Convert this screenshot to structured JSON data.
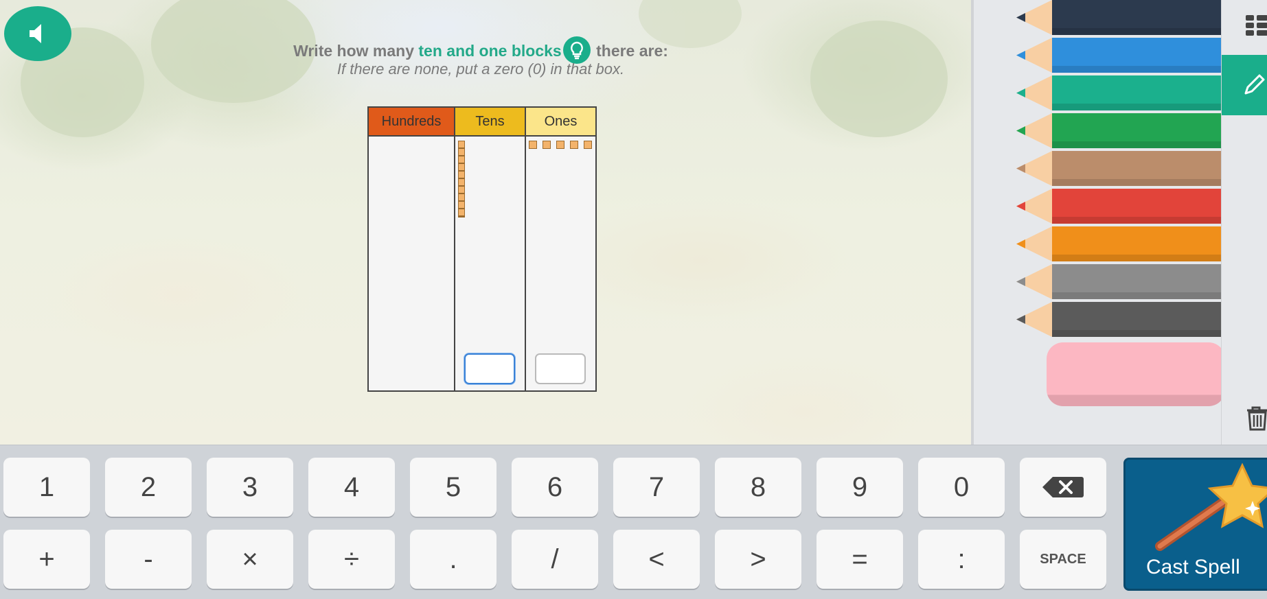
{
  "prompt": {
    "part1": "Write how many ",
    "highlight": "ten and one blocks",
    "part2": " there are:",
    "line2": "If there are none, put a zero (0) in that box."
  },
  "place_value": {
    "headers": [
      "Hundreds",
      "Tens",
      "Ones"
    ],
    "hundreds_blocks": 0,
    "tens_blocks": 1,
    "ones_blocks": 5,
    "tens_answer": "",
    "ones_answer": ""
  },
  "pencils": [
    {
      "name": "navy",
      "color": "#2c3a4e"
    },
    {
      "name": "blue",
      "color": "#2f8fdc"
    },
    {
      "name": "teal",
      "color": "#1bb08d"
    },
    {
      "name": "green",
      "color": "#22a552"
    },
    {
      "name": "tan",
      "color": "#bb8d6b"
    },
    {
      "name": "red",
      "color": "#e2443a"
    },
    {
      "name": "orange",
      "color": "#f08f1a"
    },
    {
      "name": "gray",
      "color": "#8c8c8c"
    },
    {
      "name": "dark-gray",
      "color": "#5b5b5b"
    }
  ],
  "keyboard": {
    "row1": [
      "1",
      "2",
      "3",
      "4",
      "5",
      "6",
      "7",
      "8",
      "9",
      "0"
    ],
    "row2": [
      "+",
      "-",
      "×",
      "÷",
      ".",
      "/",
      "<",
      ">",
      "=",
      ":"
    ],
    "space_label": "SPACE",
    "cast_label": "Cast Spell"
  },
  "icons": {
    "sound": "speaker-icon",
    "hint": "lightbulb-icon",
    "backspace": "backspace-icon",
    "menu": "grid-icon",
    "pencil_tool": "pencil-icon",
    "trash": "trash-icon",
    "wand": "magic-wand-icon"
  },
  "colors": {
    "accent": "#1aae8b",
    "hundreds": "#e05a1a",
    "tens": "#edbb1e",
    "ones": "#fbe58a",
    "cast_button": "#0a5f8c"
  }
}
